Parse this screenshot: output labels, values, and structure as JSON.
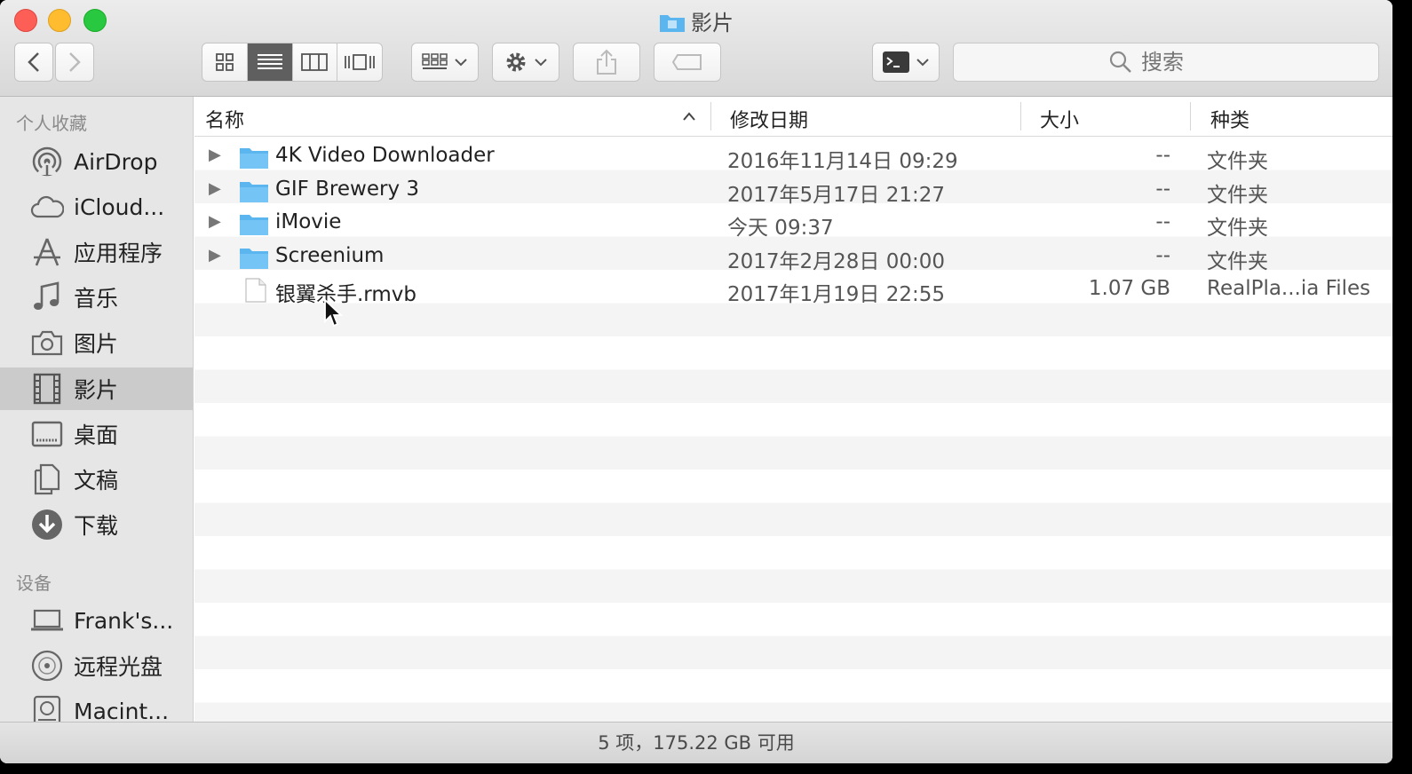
{
  "window": {
    "title": "影片"
  },
  "toolbar": {
    "search_placeholder": "搜索"
  },
  "sidebar": {
    "sections": [
      {
        "heading": "个人收藏",
        "items": [
          {
            "label": "AirDrop",
            "icon": "airdrop-icon"
          },
          {
            "label": "iCloud...",
            "icon": "cloud-icon"
          },
          {
            "label": "应用程序",
            "icon": "applications-icon"
          },
          {
            "label": "音乐",
            "icon": "music-icon"
          },
          {
            "label": "图片",
            "icon": "camera-icon"
          },
          {
            "label": "影片",
            "icon": "film-icon",
            "selected": true
          },
          {
            "label": "桌面",
            "icon": "desktop-icon"
          },
          {
            "label": "文稿",
            "icon": "documents-icon"
          },
          {
            "label": "下载",
            "icon": "download-icon"
          }
        ]
      },
      {
        "heading": "设备",
        "items": [
          {
            "label": "Frank's...",
            "icon": "laptop-icon"
          },
          {
            "label": "远程光盘",
            "icon": "disc-icon"
          },
          {
            "label": "Macint...",
            "icon": "hard-drive-icon"
          }
        ]
      }
    ]
  },
  "columns": {
    "name": "名称",
    "date": "修改日期",
    "size": "大小",
    "kind": "种类"
  },
  "files": [
    {
      "name": "4K Video Downloader",
      "date": "2016年11月14日 09:29",
      "size": "--",
      "kind": "文件夹",
      "folder": true
    },
    {
      "name": "GIF Brewery 3",
      "date": "2017年5月17日 21:27",
      "size": "--",
      "kind": "文件夹",
      "folder": true
    },
    {
      "name": "iMovie",
      "date": "今天 09:37",
      "size": "--",
      "kind": "文件夹",
      "folder": true
    },
    {
      "name": "Screenium",
      "date": "2017年2月28日 00:00",
      "size": "--",
      "kind": "文件夹",
      "folder": true
    },
    {
      "name": "银翼杀手.rmvb",
      "date": "2017年1月19日 22:55",
      "size": "1.07 GB",
      "kind": "RealPla...ia Files",
      "folder": false
    }
  ],
  "status": {
    "text": "5 项，175.22 GB 可用"
  },
  "colors": {
    "folder": "#5bb6ef",
    "selection": "#cbcbcb",
    "close": "#fd5f57",
    "minimize": "#febc2e",
    "zoom": "#28c840"
  }
}
